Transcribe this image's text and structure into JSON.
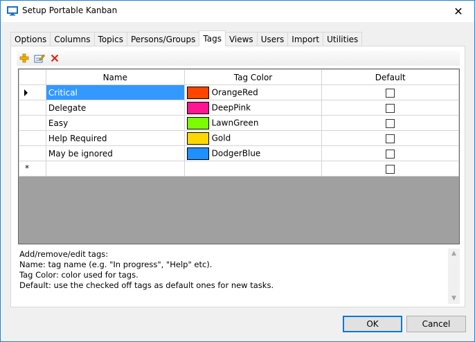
{
  "window": {
    "title": "Setup Portable Kanban",
    "close_glyph": "✕"
  },
  "tabs": [
    {
      "label": "Options"
    },
    {
      "label": "Columns"
    },
    {
      "label": "Topics"
    },
    {
      "label": "Persons/Groups"
    },
    {
      "label": "Tags",
      "active": true
    },
    {
      "label": "Views"
    },
    {
      "label": "Users"
    },
    {
      "label": "Import"
    },
    {
      "label": "Utilities"
    }
  ],
  "toolbar": {
    "icons": [
      "add-icon",
      "edit-icon",
      "delete-icon"
    ]
  },
  "grid": {
    "headers": {
      "name": "Name",
      "color": "Tag Color",
      "default": "Default"
    },
    "rows": [
      {
        "name": "Critical",
        "color_name": "OrangeRed",
        "color": "#ff4500",
        "default": false
      },
      {
        "name": "Delegate",
        "color_name": "DeepPink",
        "color": "#ff1493",
        "default": false
      },
      {
        "name": "Easy",
        "color_name": "LawnGreen",
        "color": "#7cfc00",
        "default": false
      },
      {
        "name": "Help Required",
        "color_name": "Gold",
        "color": "#ffd700",
        "default": false
      },
      {
        "name": "May be ignored",
        "color_name": "DodgerBlue",
        "color": "#1e90ff",
        "default": false
      }
    ],
    "new_row_marker": "*"
  },
  "help": {
    "line1": "Add/remove/edit tags:",
    "line2": "Name: tag name (e.g. \"In progress\", \"Help\" etc).",
    "line3": "Tag Color: color used for tags.",
    "line4": "Default: use the checked off tags as default ones for new tasks."
  },
  "buttons": {
    "ok": "OK",
    "cancel": "Cancel"
  },
  "colors": {
    "accent": "#0078d7",
    "selection": "#3399ff"
  }
}
